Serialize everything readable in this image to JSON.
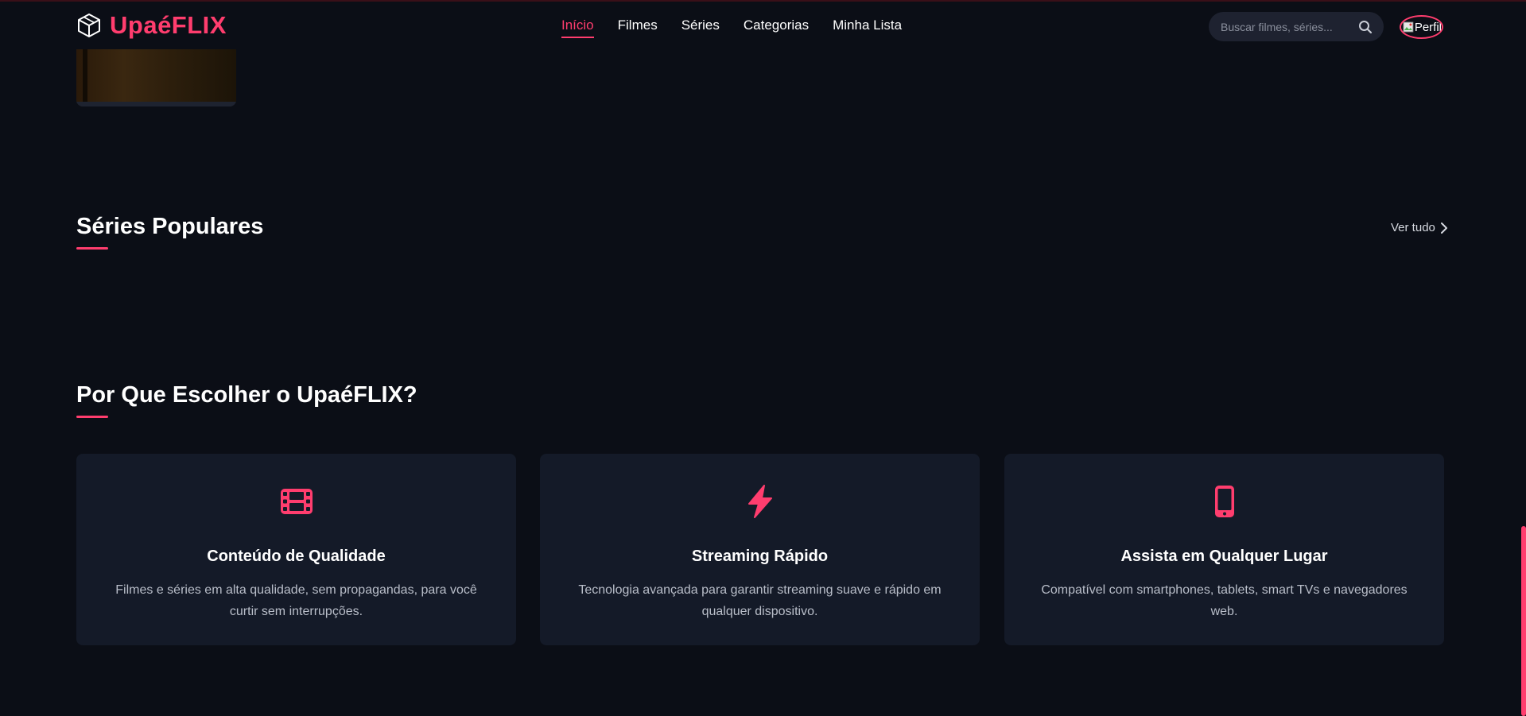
{
  "brand": {
    "name": "UpaéFLIX",
    "accent_color": "#ff3d6e",
    "logo_icon": "cube-icon"
  },
  "nav": {
    "items": [
      {
        "label": "Início",
        "active": true
      },
      {
        "label": "Filmes",
        "active": false
      },
      {
        "label": "Séries",
        "active": false
      },
      {
        "label": "Categorias",
        "active": false
      },
      {
        "label": "Minha Lista",
        "active": false
      }
    ]
  },
  "search": {
    "placeholder": "Buscar filmes, séries...",
    "icon": "search-icon"
  },
  "profile": {
    "alt_text": "Perfil"
  },
  "sections": {
    "popular_series": {
      "title": "Séries Populares",
      "see_all": "Ver tudo"
    },
    "why_choose": {
      "title": "Por Que Escolher o UpaéFLIX?"
    }
  },
  "features": [
    {
      "icon": "film-icon",
      "title": "Conteúdo de Qualidade",
      "description": "Filmes e séries em alta qualidade, sem propagandas, para você curtir sem interrupções."
    },
    {
      "icon": "bolt-icon",
      "title": "Streaming Rápido",
      "description": "Tecnologia avançada para garantir streaming suave e rápido em qualquer dispositivo."
    },
    {
      "icon": "mobile-icon",
      "title": "Assista em Qualquer Lugar",
      "description": "Compatível com smartphones, tablets, smart TVs e navegadores web."
    }
  ]
}
